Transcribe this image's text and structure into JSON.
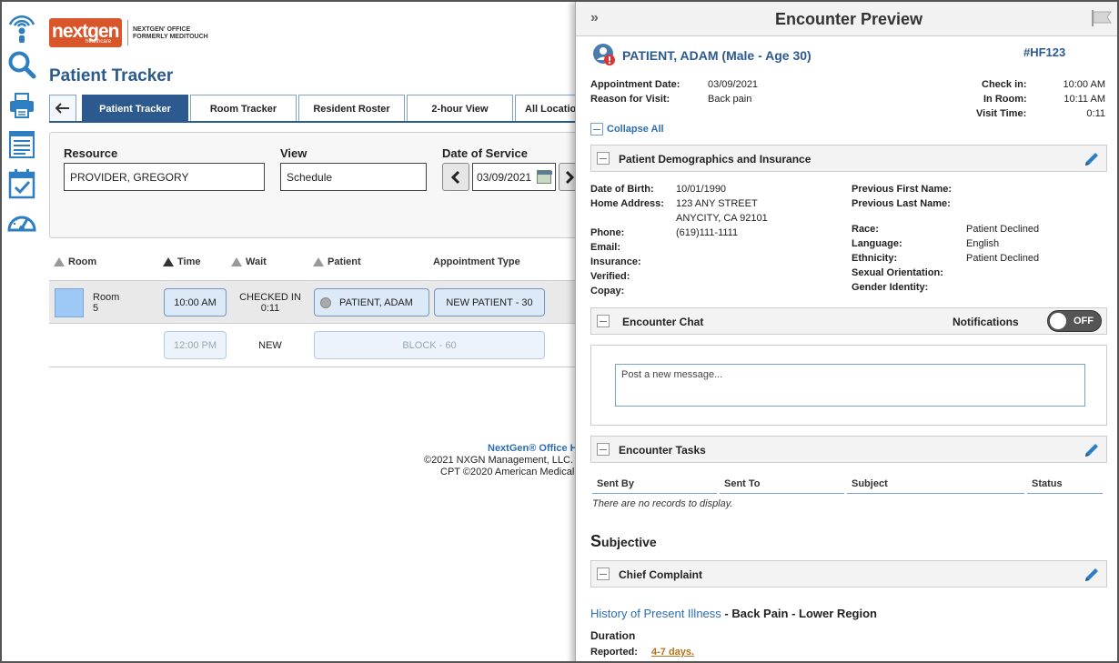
{
  "app": {
    "logo_text": "nextgen",
    "logo_sub": "healthcare",
    "logo_tagline_1": "NEXTGEN' OFFICE",
    "logo_tagline_2": "FORMERLY MEDITOUCH",
    "page_title": "Patient Tracker"
  },
  "rail_icons": [
    "broadcast-icon",
    "search-icon",
    "printer-icon",
    "document-icon",
    "calendar-check-icon",
    "dashboard-icon"
  ],
  "tabs": [
    {
      "label": "Patient Tracker",
      "active": true
    },
    {
      "label": "Room Tracker",
      "active": false
    },
    {
      "label": "Resident Roster",
      "active": false
    },
    {
      "label": "2-hour View",
      "active": false
    },
    {
      "label": "All Locatio",
      "active": false
    }
  ],
  "filter": {
    "resource_label": "Resource",
    "resource_value": "PROVIDER, GREGORY",
    "view_label": "View",
    "view_value": "Schedule",
    "date_label": "Date of Service",
    "date_value": "03/09/2021"
  },
  "tracker": {
    "headers": [
      "Room",
      "Time",
      "Wait",
      "Patient",
      "Appointment Type"
    ],
    "rows": [
      {
        "room": "Room 5",
        "room_line1": "Room",
        "room_line2": "5",
        "time": "10:00 AM",
        "wait_line1": "CHECKED IN",
        "wait_line2": "0:11",
        "patient": "PATIENT, ADAM",
        "appt": "NEW PATIENT - 30"
      },
      {
        "room": "",
        "time": "12:00 PM",
        "wait_line1": "NEW",
        "wait_line2": "",
        "patient": "",
        "appt": "BLOCK - 60"
      }
    ]
  },
  "footer": {
    "brand": "NextGen® Office H",
    "line2": "©2021 NXGN Management, LLC.",
    "line3": "CPT ©2020 American Medical"
  },
  "preview": {
    "title": "Encounter Preview",
    "patient_name": "PATIENT, ADAM (Male - Age 30)",
    "id": "#HF123",
    "appt_date_label": "Appointment Date:",
    "appt_date": "03/09/2021",
    "reason_label": "Reason for Visit:",
    "reason": "Back pain",
    "checkin_label": "Check in:",
    "checkin": "10:00 AM",
    "inroom_label": "In Room:",
    "inroom": "10:11 AM",
    "visittime_label": "Visit Time:",
    "visittime": "0:11",
    "collapse_all": "Collapse All",
    "demographics": {
      "title": "Patient Demographics and Insurance",
      "dob_label": "Date of Birth:",
      "dob": "10/01/1990",
      "address_label": "Home Address:",
      "address_1": "123 ANY STREET",
      "address_2": "ANYCITY, CA 92101",
      "phone_label": "Phone:",
      "phone": "(619)111-1111",
      "email_label": "Email:",
      "insurance_label": "Insurance:",
      "verified_label": "Verified:",
      "copay_label": "Copay:",
      "prev_first_label": "Previous First Name:",
      "prev_last_label": "Previous Last Name:",
      "race_label": "Race:",
      "race": "Patient Declined",
      "language_label": "Language:",
      "language": "English",
      "ethnicity_label": "Ethnicity:",
      "ethnicity": "Patient Declined",
      "orientation_label": "Sexual Orientation:",
      "gender_label": "Gender Identity:"
    },
    "chat": {
      "title": "Encounter Chat",
      "notifications_label": "Notifications",
      "toggle_state": "OFF",
      "placeholder": "Post a new message..."
    },
    "tasks": {
      "title": "Encounter Tasks",
      "columns": [
        "Sent By",
        "Sent To",
        "Subject",
        "Status"
      ],
      "empty": "There are no records to display."
    },
    "subjective_initial": "S",
    "subjective_rest": "ubjective",
    "chief_complaint": "Chief Complaint",
    "hpi_link": "History of Present Illness",
    "hpi_sep": " - ",
    "hpi_value": "Back Pain - Lower Region",
    "duration_label": "Duration",
    "reported_label": "Reported:",
    "reported_value": "4-7 days."
  },
  "colors": {
    "brand_blue": "#2c5a8e",
    "link_blue": "#2c6db5",
    "nextgen_orange": "#d9562b",
    "room_swatch": "#9ec8f6"
  }
}
